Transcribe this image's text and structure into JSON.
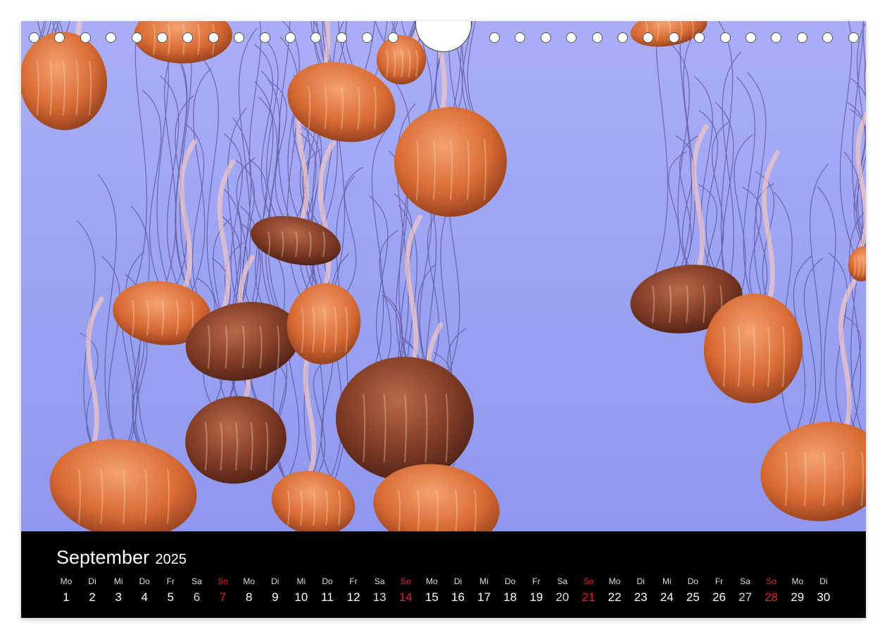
{
  "calendar": {
    "month": "September",
    "year": "2025",
    "sunday_color": "#e0242c",
    "days": [
      {
        "dow": "Mo",
        "num": "1"
      },
      {
        "dow": "Di",
        "num": "2"
      },
      {
        "dow": "Mi",
        "num": "3"
      },
      {
        "dow": "Do",
        "num": "4"
      },
      {
        "dow": "Fr",
        "num": "5"
      },
      {
        "dow": "Sa",
        "num": "6"
      },
      {
        "dow": "So",
        "num": "7"
      },
      {
        "dow": "Mo",
        "num": "8"
      },
      {
        "dow": "Di",
        "num": "9"
      },
      {
        "dow": "Mi",
        "num": "10"
      },
      {
        "dow": "Do",
        "num": "11"
      },
      {
        "dow": "Fr",
        "num": "12"
      },
      {
        "dow": "Sa",
        "num": "13"
      },
      {
        "dow": "So",
        "num": "14"
      },
      {
        "dow": "Mo",
        "num": "15"
      },
      {
        "dow": "Di",
        "num": "16"
      },
      {
        "dow": "Mi",
        "num": "17"
      },
      {
        "dow": "Do",
        "num": "18"
      },
      {
        "dow": "Fr",
        "num": "19"
      },
      {
        "dow": "Sa",
        "num": "20"
      },
      {
        "dow": "So",
        "num": "21"
      },
      {
        "dow": "Mo",
        "num": "22"
      },
      {
        "dow": "Di",
        "num": "23"
      },
      {
        "dow": "Mi",
        "num": "24"
      },
      {
        "dow": "Do",
        "num": "25"
      },
      {
        "dow": "Fr",
        "num": "26"
      },
      {
        "dow": "Sa",
        "num": "27"
      },
      {
        "dow": "So",
        "num": "28"
      },
      {
        "dow": "Mo",
        "num": "29"
      },
      {
        "dow": "Di",
        "num": "30"
      }
    ]
  },
  "photo": {
    "subject": "jellyfish",
    "background_color": "#9ea6f2",
    "jelly_color": "#e0793f"
  }
}
